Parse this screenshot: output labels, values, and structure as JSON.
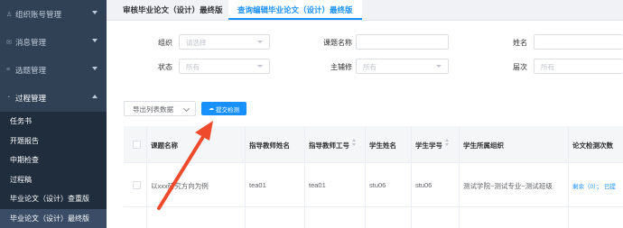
{
  "sidebar": {
    "groups": [
      {
        "label": "组织账号管理"
      },
      {
        "label": "消息管理"
      },
      {
        "label": "选题管理"
      },
      {
        "label": "过程管理"
      }
    ],
    "subitems": [
      {
        "label": "任务书"
      },
      {
        "label": "开题报告"
      },
      {
        "label": "中期检查"
      },
      {
        "label": "过程稿"
      },
      {
        "label": "毕业论文（设计）查重版"
      },
      {
        "label": "毕业论文（设计）最终版"
      }
    ]
  },
  "tabs": [
    {
      "label": "审核毕业论文（设计）最终版"
    },
    {
      "label": "查询编辑毕业论文（设计）最终版"
    }
  ],
  "filters": {
    "org_label": "组织",
    "org_placeholder": "请选择",
    "status_label": "状态",
    "status_placeholder": "所有",
    "title_label": "课题名称",
    "role_label": "主辅修",
    "role_placeholder": "所有",
    "name_label": "姓名",
    "batch_label": "届次",
    "batch_placeholder": "所有"
  },
  "toolbar": {
    "export_label": "导出列表数据",
    "submit_label": "提交检测"
  },
  "table": {
    "headers": [
      "课题名称",
      "指导教师姓名",
      "指导教师工号",
      "学生姓名",
      "学生学号",
      "学生所属组织",
      "论文检测次数"
    ],
    "row": {
      "title": "以xxx研究方向为例",
      "teacher_name": "tea01",
      "teacher_id": "tea01",
      "student_name": "stu06",
      "student_id": "stu06",
      "org": "测试学院~测试专业~测试班级",
      "check_label": "剩余（0）；",
      "check_extra": "已提"
    }
  },
  "colors": {
    "sidebar_bg": "#304156",
    "submenu_bg": "#1f2d3d",
    "accent": "#1890ff",
    "annotation_arrow": "#f04a2c"
  }
}
